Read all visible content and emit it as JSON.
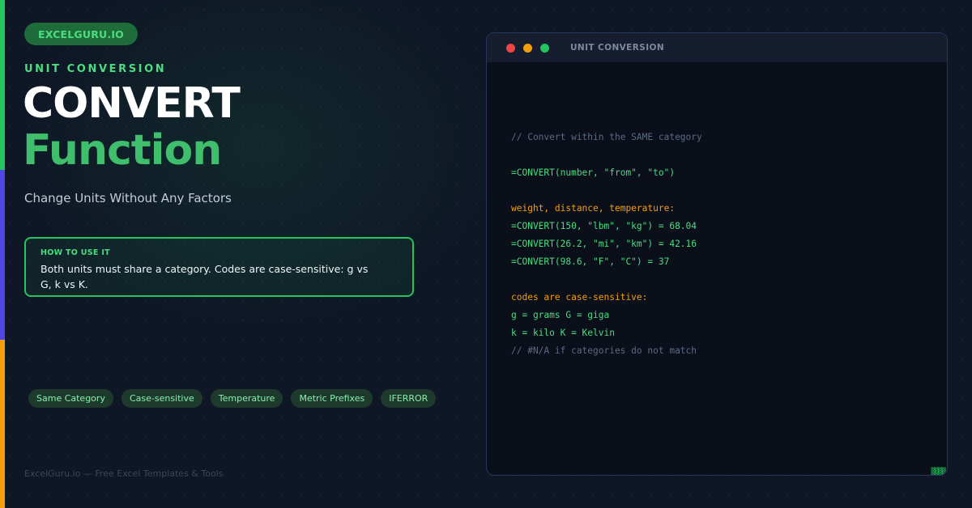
{
  "brand": {
    "pill": "EXCELGURU.IO"
  },
  "hero": {
    "eyebrow": "UNIT CONVERSION",
    "title_line1": "CONVERT",
    "title_line2": "Function",
    "subtitle": "Change Units Without Any Factors"
  },
  "howto": {
    "label": "HOW TO USE IT",
    "text": "Both units must share a category. Codes are case-sensitive: g vs G, k vs K."
  },
  "tags": [
    "Same Category",
    "Case-sensitive",
    "Temperature",
    "Metric Prefixes",
    "IFERROR"
  ],
  "footer": {
    "text": "ExcelGuru.io — Free Excel Templates & Tools"
  },
  "terminal": {
    "title": "UNIT CONVERSION",
    "lines": [
      {
        "text": "// Convert within the SAME category",
        "kind": "comment"
      },
      {
        "text": "",
        "kind": "blank"
      },
      {
        "text": "=CONVERT(number, \"from\", \"to\")",
        "kind": "code"
      },
      {
        "text": "",
        "kind": "blank"
      },
      {
        "text": "weight, distance, temperature:",
        "kind": "section"
      },
      {
        "text": "=CONVERT(150, \"lbm\", \"kg\") = 68.04",
        "kind": "code"
      },
      {
        "text": "=CONVERT(26.2, \"mi\", \"km\") = 42.16",
        "kind": "code"
      },
      {
        "text": "=CONVERT(98.6, \"F\", \"C\") = 37",
        "kind": "code"
      },
      {
        "text": "",
        "kind": "blank"
      },
      {
        "text": "codes are case-sensitive:",
        "kind": "section"
      },
      {
        "text": "g = grams G = giga",
        "kind": "code"
      },
      {
        "text": "k = kilo K = Kelvin",
        "kind": "code"
      },
      {
        "text": "// #N/A if categories do not match",
        "kind": "comment"
      }
    ]
  },
  "colors": {
    "background": "#0f1726",
    "accent_green": "#22c55e",
    "accent_blue": "#4f46e5",
    "accent_orange": "#f59e0b",
    "title_green": "#3fbf6b",
    "terminal_bg": "#0a0f1a"
  },
  "icons": [
    "window-close-dot-icon",
    "window-minimize-dot-icon",
    "window-maximize-dot-icon"
  ]
}
